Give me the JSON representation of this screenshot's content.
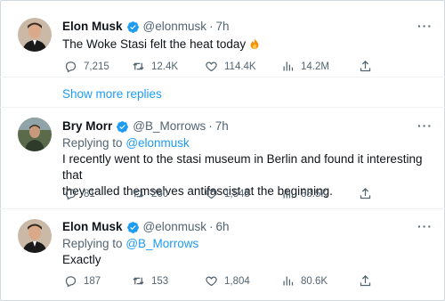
{
  "tweets": [
    {
      "name": "Elon Musk",
      "handle": "@elonmusk",
      "time": "7h",
      "text": "The Woke Stasi felt the heat today",
      "emoji": "fire-emoji",
      "stats": {
        "replies": "7,215",
        "retweets": "12.4K",
        "likes": "114.4K",
        "views": "14.2M"
      }
    },
    {
      "name": "Bry Morr",
      "handle": "@B_Morrows",
      "time": "7h",
      "replying_label": "Replying to",
      "replying_to": "@elonmusk",
      "text_line1": "I recently went to the stasi museum in Berlin and found it interesting that",
      "text_line2": "they called themselves antifascist at the beginning.",
      "stats": {
        "replies": "81",
        "retweets": "260",
        "likes": "1,543",
        "views": "88.5K"
      }
    },
    {
      "name": "Elon Musk",
      "handle": "@elonmusk",
      "time": "6h",
      "replying_label": "Replying to",
      "replying_to": "@B_Morrows",
      "text": "Exactly",
      "stats": {
        "replies": "187",
        "retweets": "153",
        "likes": "1,804",
        "views": "80.6K"
      }
    }
  ],
  "show_more": "Show more replies",
  "separator_dot": "·",
  "more_icon": "···",
  "colors": {
    "accent": "#1d9bf0",
    "muted": "#536471",
    "text": "#0f1419"
  }
}
